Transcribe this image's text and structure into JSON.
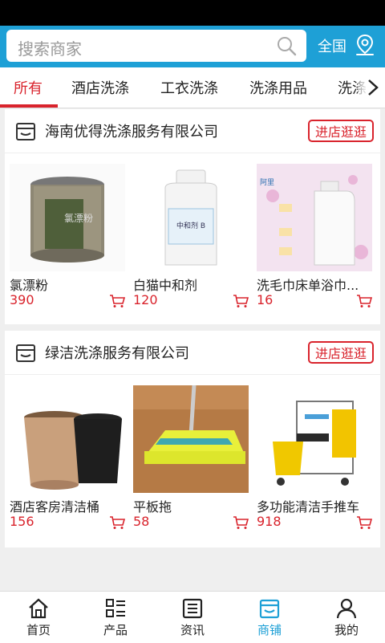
{
  "search": {
    "placeholder": "搜索商家",
    "icon": "search-icon"
  },
  "region": {
    "label": "全国",
    "icon": "location-icon"
  },
  "tabs": [
    {
      "label": "所有",
      "active": true
    },
    {
      "label": "酒店洗涤"
    },
    {
      "label": "工衣洗涤"
    },
    {
      "label": "洗涤用品"
    },
    {
      "label": "洗涤"
    }
  ],
  "shops": [
    {
      "name": "海南优得洗涤服务有限公司",
      "visit_label": "进店逛逛",
      "products": [
        {
          "name": "氯漂粉",
          "price": "390",
          "image_text": "氯漂粉"
        },
        {
          "name": "白猫中和剂",
          "price": "120",
          "image_text": "中和剂 B"
        },
        {
          "name": "洗毛巾床单浴巾...",
          "price": "16",
          "image_text": "阿里"
        }
      ]
    },
    {
      "name": "绿洁洗涤服务有限公司",
      "visit_label": "进店逛逛",
      "products": [
        {
          "name": "酒店客房清洁桶",
          "price": "156"
        },
        {
          "name": "平板拖",
          "price": "58"
        },
        {
          "name": "多功能清洁手推车",
          "price": "918"
        }
      ]
    }
  ],
  "bottom_nav": [
    {
      "label": "首页",
      "icon": "home-icon"
    },
    {
      "label": "产品",
      "icon": "product-list-icon"
    },
    {
      "label": "资讯",
      "icon": "news-icon"
    },
    {
      "label": "商铺",
      "icon": "shop-icon",
      "active": true
    },
    {
      "label": "我的",
      "icon": "user-icon"
    }
  ],
  "colors": {
    "header": "#1ea0d6",
    "accent_red": "#d9232c",
    "active_nav": "#1ea0d6"
  }
}
